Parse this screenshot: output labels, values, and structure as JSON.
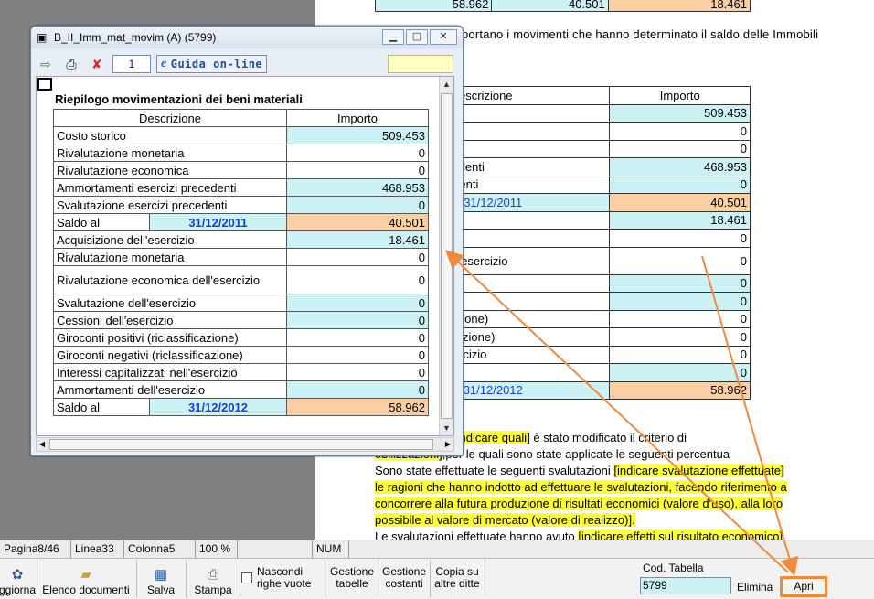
{
  "document": {
    "top_row": [
      "58.962",
      "40.501",
      "18.461"
    ],
    "paragraph": "portano i movimenti che hanno determinato il saldo delle Immobili",
    "table_header": [
      "escrizione",
      "Importo"
    ],
    "rows": [
      {
        "label": "",
        "value": "509.453"
      },
      {
        "label": "monetaria",
        "value": "0"
      },
      {
        "label": "economica",
        "value": "0"
      },
      {
        "label": "i esercizi precedenti",
        "value": "468.953"
      },
      {
        "label": "esercizi precedenti",
        "value": "0"
      },
      {
        "label": "",
        "date": "31/12/2011",
        "value": "40.501"
      },
      {
        "label": "ell'esercizio",
        "value": "18.461"
      },
      {
        "label": "monetaria",
        "value": "0"
      },
      {
        "label": "economica dell'esercizio",
        "value": "0"
      },
      {
        "label": "dell'esercizio",
        "value": "0"
      },
      {
        "label": "sercizio",
        "value": "0"
      },
      {
        "label": "tivi (riclassificazione)",
        "value": "0"
      },
      {
        "label": "ativi (riclassificazione)",
        "value": "0"
      },
      {
        "label": "alizzati nell'esercizio",
        "value": "0"
      },
      {
        "label": "i dell'esercizio",
        "value": "0"
      },
      {
        "label": "",
        "date": "31/12/2012",
        "value": "58.962"
      }
    ],
    "text_lines": [
      {
        "a": "nti motivazioni ",
        "h": "[indicare quali]",
        "b": " è stato modificato il criterio di"
      },
      {
        "a": "",
        "h": "obilizzazioni]",
        "b": ",per le quali sono state applicate le seguenti percentua"
      },
      {
        "a": "Sono state effettuate le seguenti svalutazioni ",
        "h": "[indicare svalutazione effettuate]",
        "b": ""
      },
      {
        "a": "",
        "h": "le ragioni che hanno indotto ad effettuare le svalutazioni, facendo riferimento a",
        "b": ""
      },
      {
        "a": "",
        "h": "concorrere alla futura produzione di risultati economici (valore d'uso), alla loro",
        "b": ""
      },
      {
        "a": "",
        "h": "possibile al valore di mercato (valore di realizzo)].",
        "b": ""
      },
      {
        "a": "Le svalutazioni effettuate hanno avuto ",
        "h": "[indicare effetti sul risultato economico]",
        "b": ""
      }
    ]
  },
  "window": {
    "title": "B_II_Imm_mat_movim (A) (5799)",
    "page_number": "1",
    "guida_label": "Guida on-line",
    "heading": "Riepilogo movimentazioni dei beni materiali",
    "col_description": "Descrizione",
    "col_amount": "Importo",
    "rows": [
      {
        "label": "Costo storico",
        "value": "509.453",
        "bg": "cyan"
      },
      {
        "label": "Rivalutazione monetaria",
        "value": "0",
        "bg": "white"
      },
      {
        "label": "Rivalutazione economica",
        "value": "0",
        "bg": "white"
      },
      {
        "label": "Ammortamenti esercizi precedenti",
        "value": "468.953",
        "bg": "cyan"
      },
      {
        "label": "Svalutazione esercizi precedenti",
        "value": "0",
        "bg": "cyan"
      },
      {
        "label": "Saldo al",
        "date": "31/12/2011",
        "value": "40.501",
        "bg": "orange"
      },
      {
        "label": "Acquisizione dell'esercizio",
        "value": "18.461",
        "bg": "cyan"
      },
      {
        "label": "Rivalutazione monetaria",
        "value": "0",
        "bg": "white"
      },
      {
        "label": "Rivalutazione economica dell'esercizio",
        "value": "0",
        "bg": "white"
      },
      {
        "label": "Svalutazione dell'esercizio",
        "value": "0",
        "bg": "cyan"
      },
      {
        "label": "Cessioni dell'esercizio",
        "value": "0",
        "bg": "cyan"
      },
      {
        "label": "Giroconti positivi (riclassificazione)",
        "value": "0",
        "bg": "white"
      },
      {
        "label": "Giroconti negativi (riclassificazione)",
        "value": "0",
        "bg": "white"
      },
      {
        "label": "Interessi capitalizzati nell'esercizio",
        "value": "0",
        "bg": "white"
      },
      {
        "label": "Ammortamenti dell'esercizio",
        "value": "0",
        "bg": "cyan"
      },
      {
        "label": "Saldo al",
        "date": "31/12/2012",
        "value": "58.962",
        "bg": "orange"
      }
    ]
  },
  "status_bar": [
    "Pagina8/46",
    "Linea33",
    "Colonna5",
    "100 %",
    "",
    "NUM"
  ],
  "bottom_bar": {
    "aggiorna": "ggiorna",
    "elenco": "Elenco documenti",
    "salva": "Salva",
    "stampa": "Stampa",
    "nascondi_1": "Nascondi",
    "nascondi_2": "righe vuote",
    "gestione_tabelle_1": "Gestione",
    "gestione_tabelle_2": "tabelle",
    "gestione_costanti_1": "Gestione",
    "gestione_costanti_2": "costanti",
    "copia_1": "Copia su",
    "copia_2": "altre ditte",
    "cod_tabella_label": "Cod. Tabella",
    "cod_tabella_value": "5799",
    "elimina": "Elimina",
    "apri": "Apri"
  },
  "colors": {
    "cyan": "#ccf2f5",
    "orange": "#f9cfa3",
    "highlight": "#ffff33",
    "arrow": "#f08a3a"
  }
}
